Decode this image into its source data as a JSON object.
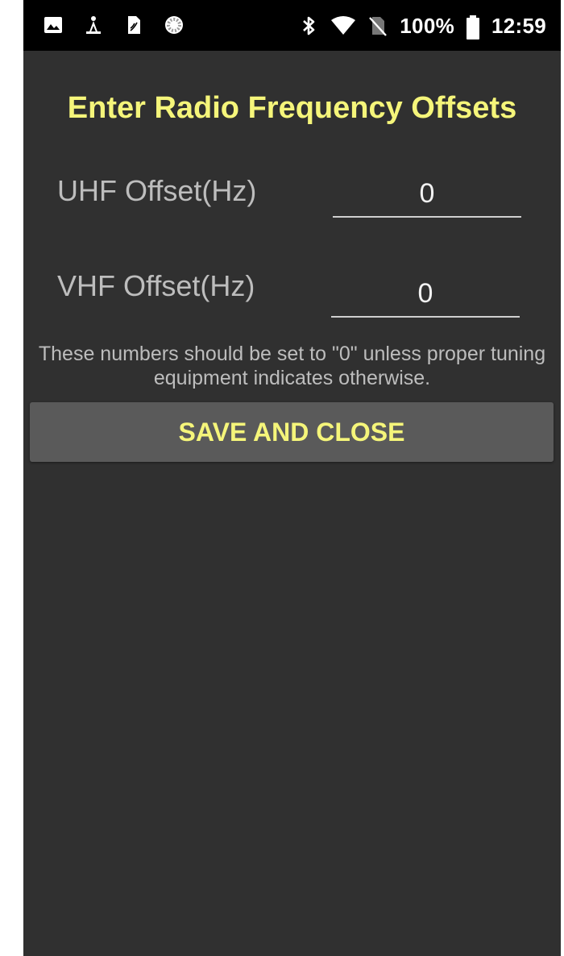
{
  "status_bar": {
    "battery_percent": "100%",
    "time": "12:59",
    "left_icons": [
      "gallery-icon",
      "radio-tower-icon",
      "sim-card-icon",
      "sync-progress-icon"
    ],
    "right_icons": [
      "bluetooth-icon",
      "wifi-icon",
      "no-sim-icon",
      "battery-icon"
    ]
  },
  "form": {
    "title": "Enter Radio Frequency Offsets",
    "uhf_label": "UHF Offset(Hz)",
    "uhf_value": "0",
    "vhf_label": "VHF Offset(Hz)",
    "vhf_value": "0",
    "note": "These numbers should be set to \"0\" unless proper tuning equipment indicates otherwise.",
    "save_label": "SAVE AND CLOSE"
  },
  "colors": {
    "accent": "#f5f57a",
    "background": "#303030",
    "button": "#5a5a5a",
    "label": "#bdbdbd"
  }
}
